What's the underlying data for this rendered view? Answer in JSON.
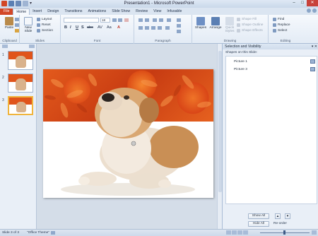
{
  "window": {
    "title": "Presentation1 - Microsoft PowerPoint"
  },
  "ribbon_tabs": [
    "File",
    "Home",
    "Insert",
    "Design",
    "Transitions",
    "Animations",
    "Slide Show",
    "Review",
    "View",
    "Infusable"
  ],
  "active_tab": "Home",
  "ribbon": {
    "clipboard": {
      "label": "Clipboard",
      "paste": "Paste"
    },
    "slides": {
      "label": "Slides",
      "new_slide": "New Slide",
      "layout": "Layout",
      "reset": "Reset",
      "section": "Section"
    },
    "font": {
      "label": "Font",
      "size": "18",
      "bold": "B",
      "italic": "I",
      "underline": "U",
      "shadow": "S",
      "strike": "abc",
      "spacing": "AV",
      "case": "Aa",
      "color": "A"
    },
    "paragraph": {
      "label": "Paragraph"
    },
    "drawing": {
      "label": "Drawing",
      "shapes": "Shapes",
      "arrange": "Arrange",
      "quick_styles": "Quick Styles",
      "shape_fill": "Shape Fill",
      "shape_outline": "Shape Outline",
      "shape_effects": "Shape Effects"
    },
    "editing": {
      "label": "Editing",
      "find": "Find",
      "replace": "Replace",
      "select": "Select"
    }
  },
  "thumbnails": [
    {
      "number": "1"
    },
    {
      "number": "2"
    },
    {
      "number": "3"
    }
  ],
  "selection_pane": {
    "title": "Selection and Visibility",
    "subtitle": "Shapes on this Slide:",
    "items": [
      "Picture 1",
      "Picture 3"
    ],
    "show_all": "Show All",
    "hide_all": "Hide All",
    "reorder": "Re-order"
  },
  "status": {
    "slide": "Slide 3 of 3",
    "theme": "\"Office Theme\""
  },
  "colors": {
    "file_tab": "#d24726",
    "ribbon_bg": "#e3ebf5",
    "accent": "#f0b43c"
  }
}
